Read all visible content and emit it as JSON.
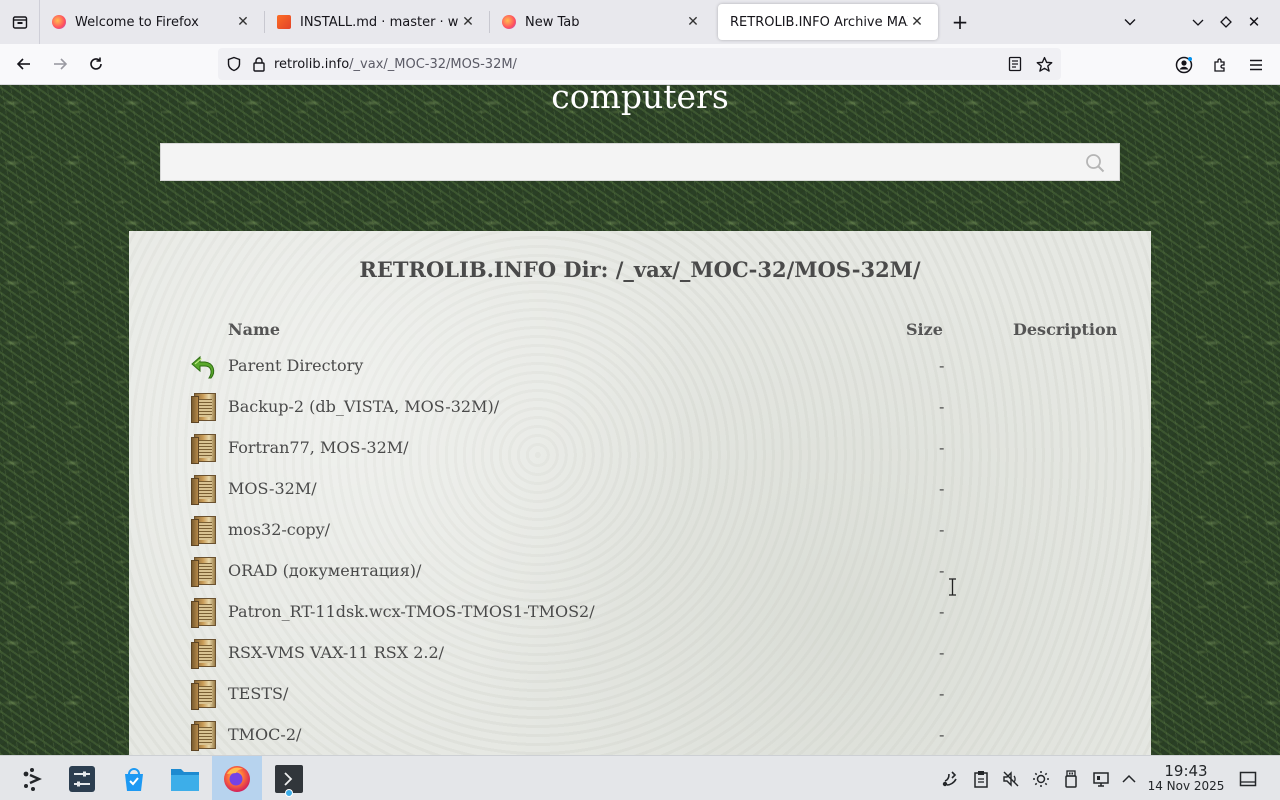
{
  "browser": {
    "tabs": [
      {
        "title": "Welcome to Firefox",
        "favicon_color": "#ff6b2b",
        "active": false
      },
      {
        "title": "INSTALL.md · master · wac",
        "favicon_color": "#e24329",
        "active": false
      },
      {
        "title": "New Tab",
        "favicon_color": "#ff6b2b",
        "active": false
      },
      {
        "title": "RETROLIB.INFO Archive MAXIC",
        "favicon_color": "",
        "active": true
      }
    ],
    "url_host": "retrolib.info",
    "url_path": "/_vax/_MOC-32/MOS-32M/"
  },
  "page": {
    "site_heading": "computers",
    "search": {
      "placeholder": ""
    },
    "dir_title": "RETROLIB.INFO Dir: /_vax/_MOC-32/MOS-32M/",
    "columns": {
      "name": "Name",
      "size": "Size",
      "description": "Description"
    },
    "entries": [
      {
        "name": "Parent Directory",
        "size": "-",
        "icon": "back-arrow-icon"
      },
      {
        "name": "Backup-2 (db_VISTA, MOS-32M)/",
        "size": "-",
        "icon": "folder-icon"
      },
      {
        "name": "Fortran77, MOS-32M/",
        "size": "-",
        "icon": "folder-icon"
      },
      {
        "name": "MOS-32M/",
        "size": "-",
        "icon": "folder-icon"
      },
      {
        "name": "mos32-copy/",
        "size": "-",
        "icon": "folder-icon"
      },
      {
        "name": "ORAD (документация)/",
        "size": "-",
        "icon": "folder-icon"
      },
      {
        "name": "Patron_RT-11dsk.wcx-TMOS-TMOS1-TMOS2/",
        "size": "-",
        "icon": "folder-icon"
      },
      {
        "name": "RSX-VMS VAX-11 RSX 2.2/",
        "size": "-",
        "icon": "folder-icon"
      },
      {
        "name": "TESTS/",
        "size": "-",
        "icon": "folder-icon"
      },
      {
        "name": "TMOC-2/",
        "size": "-",
        "icon": "folder-icon"
      }
    ]
  },
  "taskbar": {
    "apps": [
      "app-launcher-icon",
      "system-settings-icon",
      "discover-store-icon",
      "file-manager-icon",
      "firefox-icon",
      "terminal-icon"
    ],
    "tray": [
      "kde-connect-icon",
      "clipboard-icon",
      "volume-muted-icon",
      "brightness-icon",
      "usb-device-icon",
      "network-icon",
      "tray-expand-icon"
    ],
    "time": "19:43",
    "date": "14 Nov 2025"
  }
}
